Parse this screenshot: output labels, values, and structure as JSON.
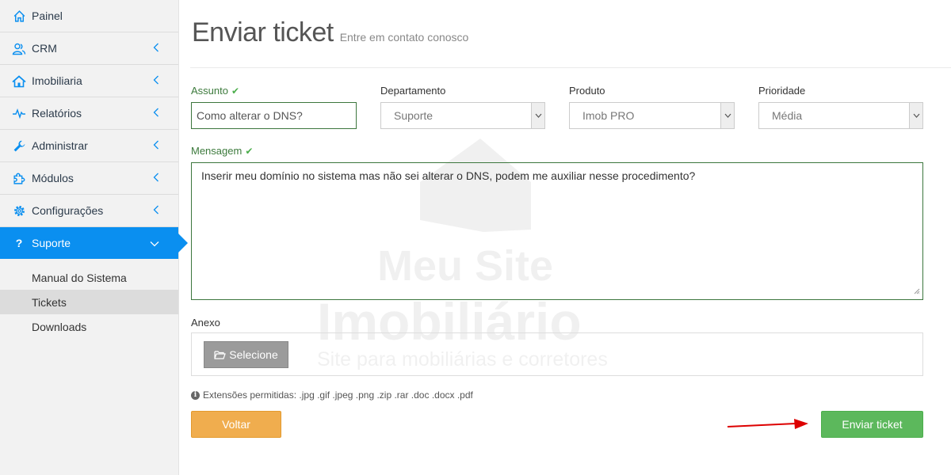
{
  "sidebar": {
    "items": [
      {
        "label": "Painel",
        "icon": "home-icon"
      },
      {
        "label": "CRM",
        "icon": "users-icon"
      },
      {
        "label": "Imobiliaria",
        "icon": "house-icon"
      },
      {
        "label": "Relatórios",
        "icon": "activity-icon"
      },
      {
        "label": "Administrar",
        "icon": "wrench-icon"
      },
      {
        "label": "Módulos",
        "icon": "puzzle-icon"
      },
      {
        "label": "Configurações",
        "icon": "gear-icon"
      },
      {
        "label": "Suporte",
        "icon": "question-icon"
      }
    ],
    "submenu": [
      {
        "label": "Manual do Sistema"
      },
      {
        "label": "Tickets"
      },
      {
        "label": "Downloads"
      }
    ],
    "active_color": "#0a8ff0"
  },
  "header": {
    "title": "Enviar ticket",
    "subtitle": "Entre em contato conosco"
  },
  "form": {
    "assunto_label": "Assunto",
    "assunto_value": "Como alterar o DNS?",
    "departamento_label": "Departamento",
    "departamento_value": "Suporte",
    "produto_label": "Produto",
    "produto_value": "Imob PRO",
    "prioridade_label": "Prioridade",
    "prioridade_value": "Média",
    "mensagem_label": "Mensagem",
    "mensagem_value": "Inserir meu domínio no sistema mas não sei alterar o DNS, podem me auxiliar nesse procedimento?",
    "anexo_label": "Anexo",
    "selecione_label": "Selecione",
    "extensoes": "Extensões permitidas: .jpg .gif .jpeg .png .zip .rar .doc .docx .pdf"
  },
  "buttons": {
    "back_label": "Voltar",
    "send_label": "Enviar ticket",
    "back_color": "#f0ad4e",
    "send_color": "#5cb85c"
  },
  "watermark": {
    "line1": "Meu Site",
    "line2": "Imobiliário",
    "line3": "Site para mobiliárias e corretores"
  }
}
